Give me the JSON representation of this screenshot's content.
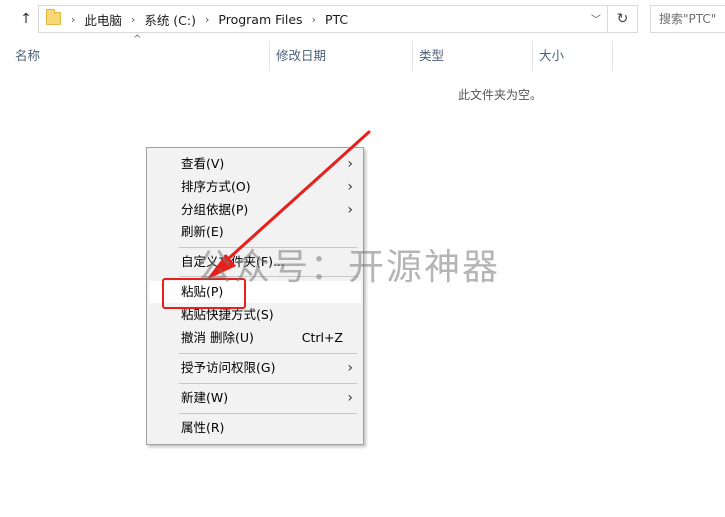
{
  "breadcrumbs": [
    "此电脑",
    "系统 (C:)",
    "Program Files",
    "PTC"
  ],
  "search": {
    "placeholder": "搜索\"PTC\""
  },
  "columns": [
    "名称",
    "修改日期",
    "类型",
    "大小"
  ],
  "empty_message": "此文件夹为空。",
  "context_menu": {
    "view": "查看(V)",
    "sort_by": "排序方式(O)",
    "group_by": "分组依据(P)",
    "refresh": "刷新(E)",
    "customize": "自定义文件夹(F)...",
    "paste": "粘贴(P)",
    "paste_shortcut": "粘贴快捷方式(S)",
    "undo": "撤消 删除(U)",
    "undo_shortcut": "Ctrl+Z",
    "grant_access": "授予访问权限(G)",
    "new": "新建(W)",
    "properties": "属性(R)"
  },
  "watermark": "公众号：开源神器",
  "colors": {
    "annotation_red": "#e8201b",
    "menu_bg": "#f2f2f2",
    "header_text": "#4c607a"
  },
  "icons": [
    "up-arrow-icon",
    "folder-icon",
    "chevron-right-icon",
    "chevron-down-icon",
    "refresh-icon",
    "submenu-arrow-icon"
  ]
}
